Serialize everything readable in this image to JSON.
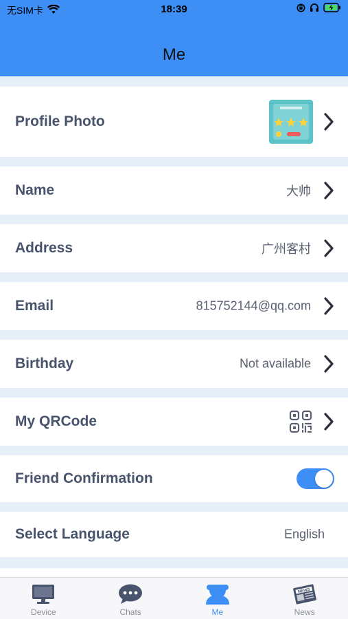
{
  "status_bar": {
    "carrier": "无SIM卡",
    "time": "18:39"
  },
  "header": {
    "title": "Me"
  },
  "rows": {
    "profile_photo": {
      "label": "Profile Photo"
    },
    "name": {
      "label": "Name",
      "value": "大帅"
    },
    "address": {
      "label": "Address",
      "value": "广州客村"
    },
    "email": {
      "label": "Email",
      "value": "815752144@qq.com"
    },
    "birthday": {
      "label": "Birthday",
      "value": "Not available"
    },
    "qrcode": {
      "label": "My QRCode"
    },
    "friend_confirmation": {
      "label": "Friend Confirmation",
      "enabled": true
    },
    "language": {
      "label": "Select Language",
      "value": "English"
    }
  },
  "tabbar": {
    "tabs": [
      {
        "label": "Device",
        "icon": "monitor-icon"
      },
      {
        "label": "Chats",
        "icon": "chat-bubble-icon"
      },
      {
        "label": "Me",
        "icon": "person-icon",
        "active": true
      },
      {
        "label": "News",
        "icon": "newspaper-icon"
      }
    ]
  },
  "colors": {
    "accent": "#3d8ff5",
    "background": "#e6eff8",
    "label": "#48536c",
    "value": "#5a6070",
    "tab_inactive": "#48536c"
  }
}
